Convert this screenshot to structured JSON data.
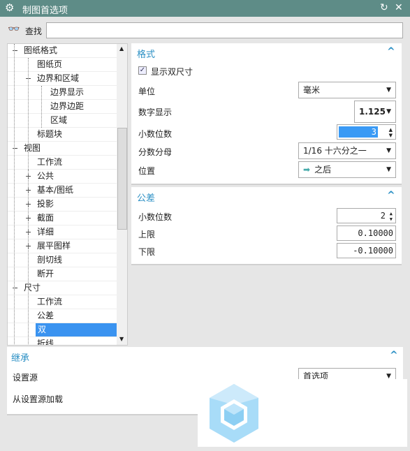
{
  "window": {
    "title": "制图首选项",
    "icon": "gear-icon"
  },
  "search": {
    "label": "查找",
    "value": ""
  },
  "tree": [
    {
      "label": "图纸格式",
      "level": 0,
      "exp": "−"
    },
    {
      "label": "图纸页",
      "level": 1
    },
    {
      "label": "边界和区域",
      "level": 1,
      "exp": "−"
    },
    {
      "label": "边界显示",
      "level": 2
    },
    {
      "label": "边界边距",
      "level": 2
    },
    {
      "label": "区域",
      "level": 2
    },
    {
      "label": "标题块",
      "level": 1
    },
    {
      "label": "视图",
      "level": 0,
      "exp": "−"
    },
    {
      "label": "工作流",
      "level": 1
    },
    {
      "label": "公共",
      "level": 1,
      "exp": "+"
    },
    {
      "label": "基本/图纸",
      "level": 1,
      "exp": "+"
    },
    {
      "label": "投影",
      "level": 1,
      "exp": "+"
    },
    {
      "label": "截面",
      "level": 1,
      "exp": "+"
    },
    {
      "label": "详细",
      "level": 1,
      "exp": "+"
    },
    {
      "label": "展平图样",
      "level": 1,
      "exp": "+"
    },
    {
      "label": "剖切线",
      "level": 1
    },
    {
      "label": "断开",
      "level": 1
    },
    {
      "label": "尺寸",
      "level": 0,
      "exp": "−"
    },
    {
      "label": "工作流",
      "level": 1
    },
    {
      "label": "公差",
      "level": 1
    },
    {
      "label": "双",
      "level": 1,
      "selected": true
    },
    {
      "label": "折线",
      "level": 1
    }
  ],
  "format": {
    "title": "格式",
    "show_dual": "显示双尺寸",
    "show_dual_checked": true,
    "unit_label": "单位",
    "unit_value": "毫米",
    "numdisp_label": "数字显示",
    "numdisp_value": "1.125",
    "decimals_label": "小数位数",
    "decimals_value": "3",
    "denom_label": "分数分母",
    "denom_value": "1/16 十六分之一",
    "pos_label": "位置",
    "pos_value": "之后"
  },
  "tolerance": {
    "title": "公差",
    "decimals_label": "小数位数",
    "decimals_value": "2",
    "upper_label": "上限",
    "upper_value": "0.10000",
    "lower_label": "下限",
    "lower_value": "-0.10000"
  },
  "inherit": {
    "title": "继承",
    "source_label": "设置源",
    "source_value": "首选项",
    "load_label": "从设置源加载"
  }
}
